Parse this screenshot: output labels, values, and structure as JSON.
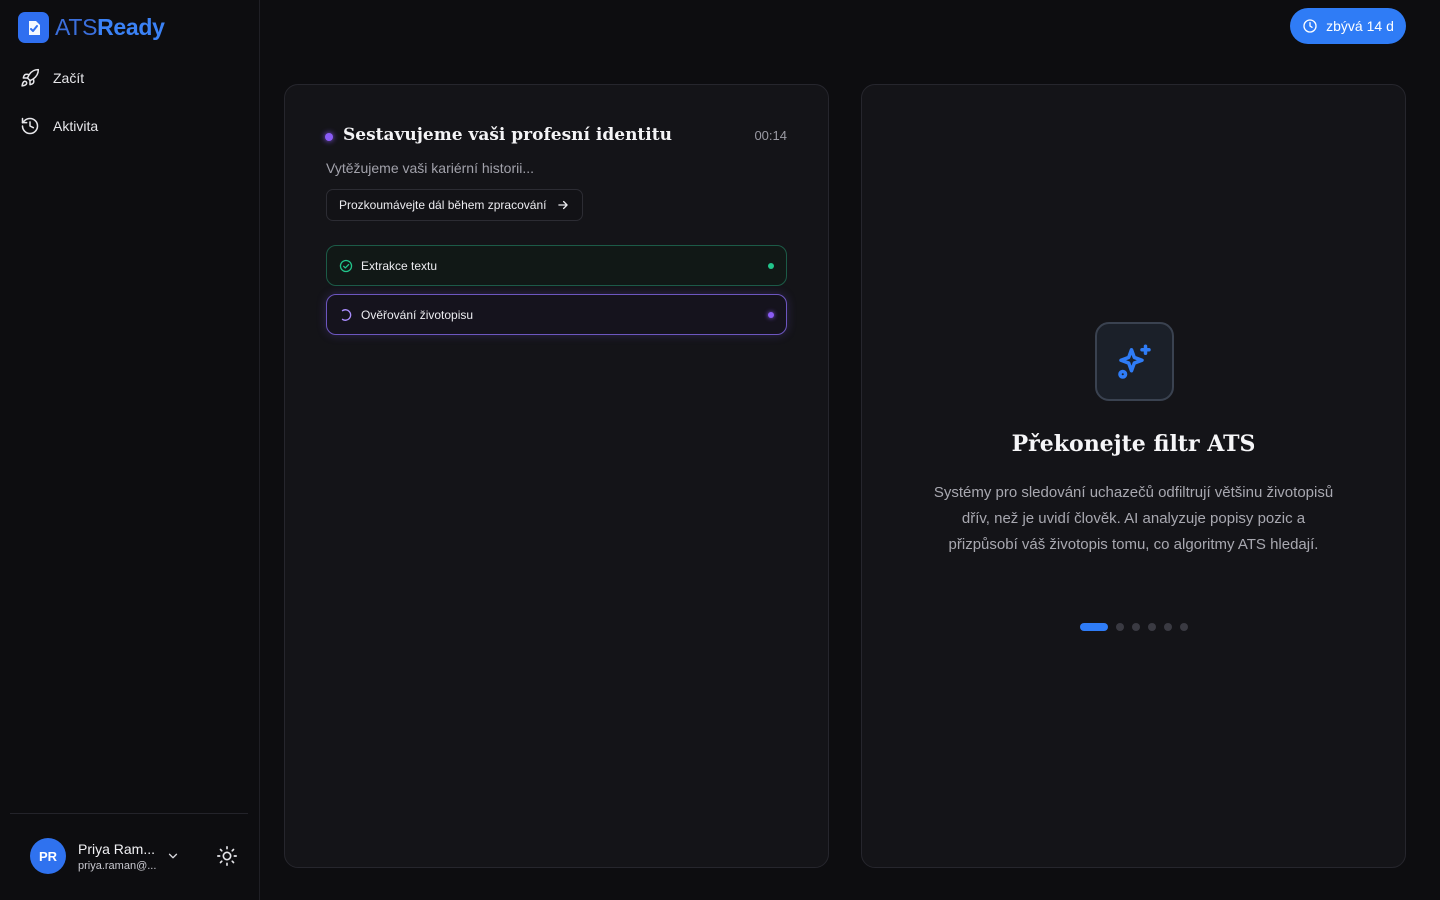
{
  "brand": {
    "name_part1": "ATS",
    "name_part2": "Ready"
  },
  "nav": [
    {
      "label": "Začít",
      "icon": "rocket-icon"
    },
    {
      "label": "Aktivita",
      "icon": "history-icon"
    }
  ],
  "user": {
    "initials": "PR",
    "name": "Priya Ram...",
    "email": "priya.raman@..."
  },
  "trial": {
    "label": "zbývá 14 d",
    "icon": "clock-icon"
  },
  "processing": {
    "title": "Sestavujeme vaši profesní identitu",
    "timer": "00:14",
    "subtitle": "Vytěžujeme vaši kariérní historii...",
    "explore_label": "Prozkoumávejte dál během zpracování",
    "steps": [
      {
        "label": "Extrakce textu",
        "status": "done"
      },
      {
        "label": "Ověřování životopisu",
        "status": "in-progress"
      }
    ]
  },
  "feature": {
    "title": "Překonejte filtr ATS",
    "description": "Systémy pro sledování uchazečů odfiltrují většinu životopisů dřív, než je uvidí člověk. AI analyzuje popisy pozic a přizpůsobí váš životopis tomu, co algoritmy ATS hledají.",
    "pager_total": 6,
    "pager_active": 1
  },
  "colors": {
    "accent": "#2f7cf6",
    "success": "#22c58b",
    "progress": "#8b5cf6",
    "background": "#0d0d10",
    "card": "#141418"
  }
}
